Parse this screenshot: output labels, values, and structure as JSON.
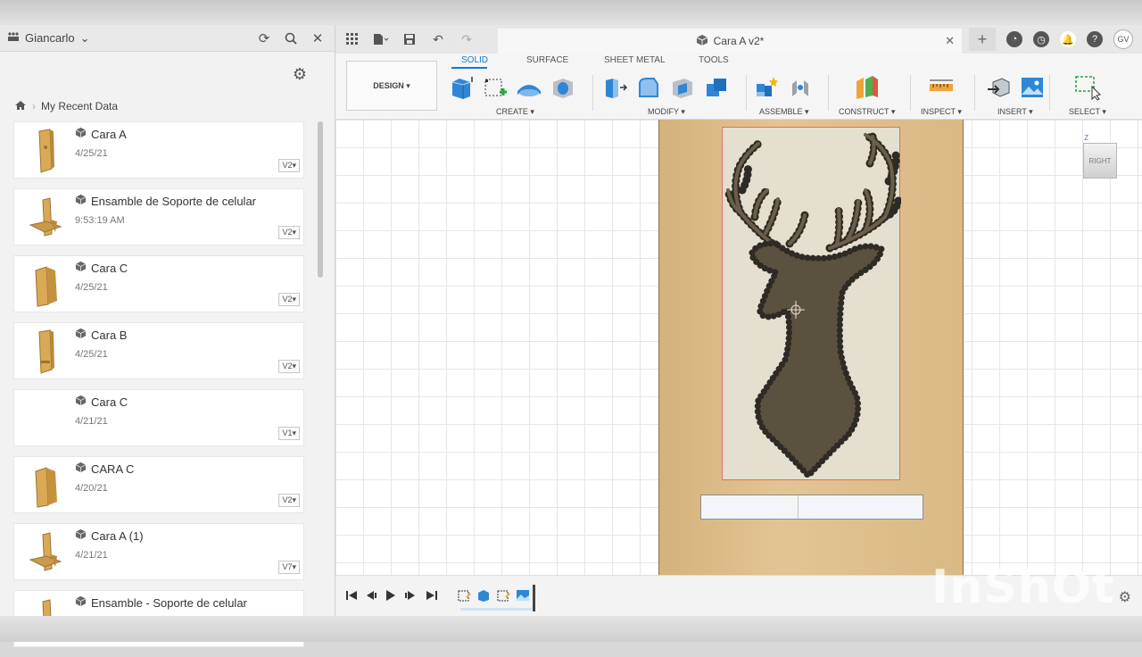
{
  "left_panel": {
    "user_name": "Giancarlo",
    "breadcrumb": "My Recent Data",
    "items": [
      {
        "name": "Cara A",
        "date": "4/25/21",
        "version": "V2▾",
        "thumb": "panel"
      },
      {
        "name": "Ensamble de Soporte de celular",
        "date": "9:53:19 AM",
        "version": "V2▾",
        "thumb": "stand"
      },
      {
        "name": "Cara C",
        "date": "4/25/21",
        "version": "V2▾",
        "thumb": "panel-wide"
      },
      {
        "name": "Cara B",
        "date": "4/25/21",
        "version": "V2▾",
        "thumb": "panel-notch"
      },
      {
        "name": "Cara C",
        "date": "4/21/21",
        "version": "V1▾",
        "thumb": "none"
      },
      {
        "name": "CARA C",
        "date": "4/20/21",
        "version": "V2▾",
        "thumb": "panel-wide"
      },
      {
        "name": "Cara A (1)",
        "date": "4/21/21",
        "version": "V7▾",
        "thumb": "stand"
      },
      {
        "name": "Ensamble - Soporte de celular",
        "date": "",
        "version": "",
        "thumb": "stand"
      }
    ]
  },
  "appbar": {
    "document_title": "Cara A v2*",
    "avatar_initials": "GV"
  },
  "toolbar": {
    "workspace": "DESIGN ▾",
    "tabs": [
      "SOLID",
      "SURFACE",
      "SHEET METAL",
      "TOOLS"
    ],
    "active_tab": "SOLID",
    "groups": [
      "CREATE ▾",
      "MODIFY ▾",
      "ASSEMBLE ▾",
      "CONSTRUCT ▾",
      "INSPECT ▾",
      "INSERT ▾",
      "SELECT ▾"
    ]
  },
  "viewport": {
    "viewcube_label": "RIGHT",
    "axis_label": "Z"
  },
  "watermark": "InShOt",
  "colors": {
    "accent": "#1a77c9",
    "wood": "#d9b985",
    "silhouette": "#5b513f",
    "sketch_outline": "#e36b6b"
  }
}
